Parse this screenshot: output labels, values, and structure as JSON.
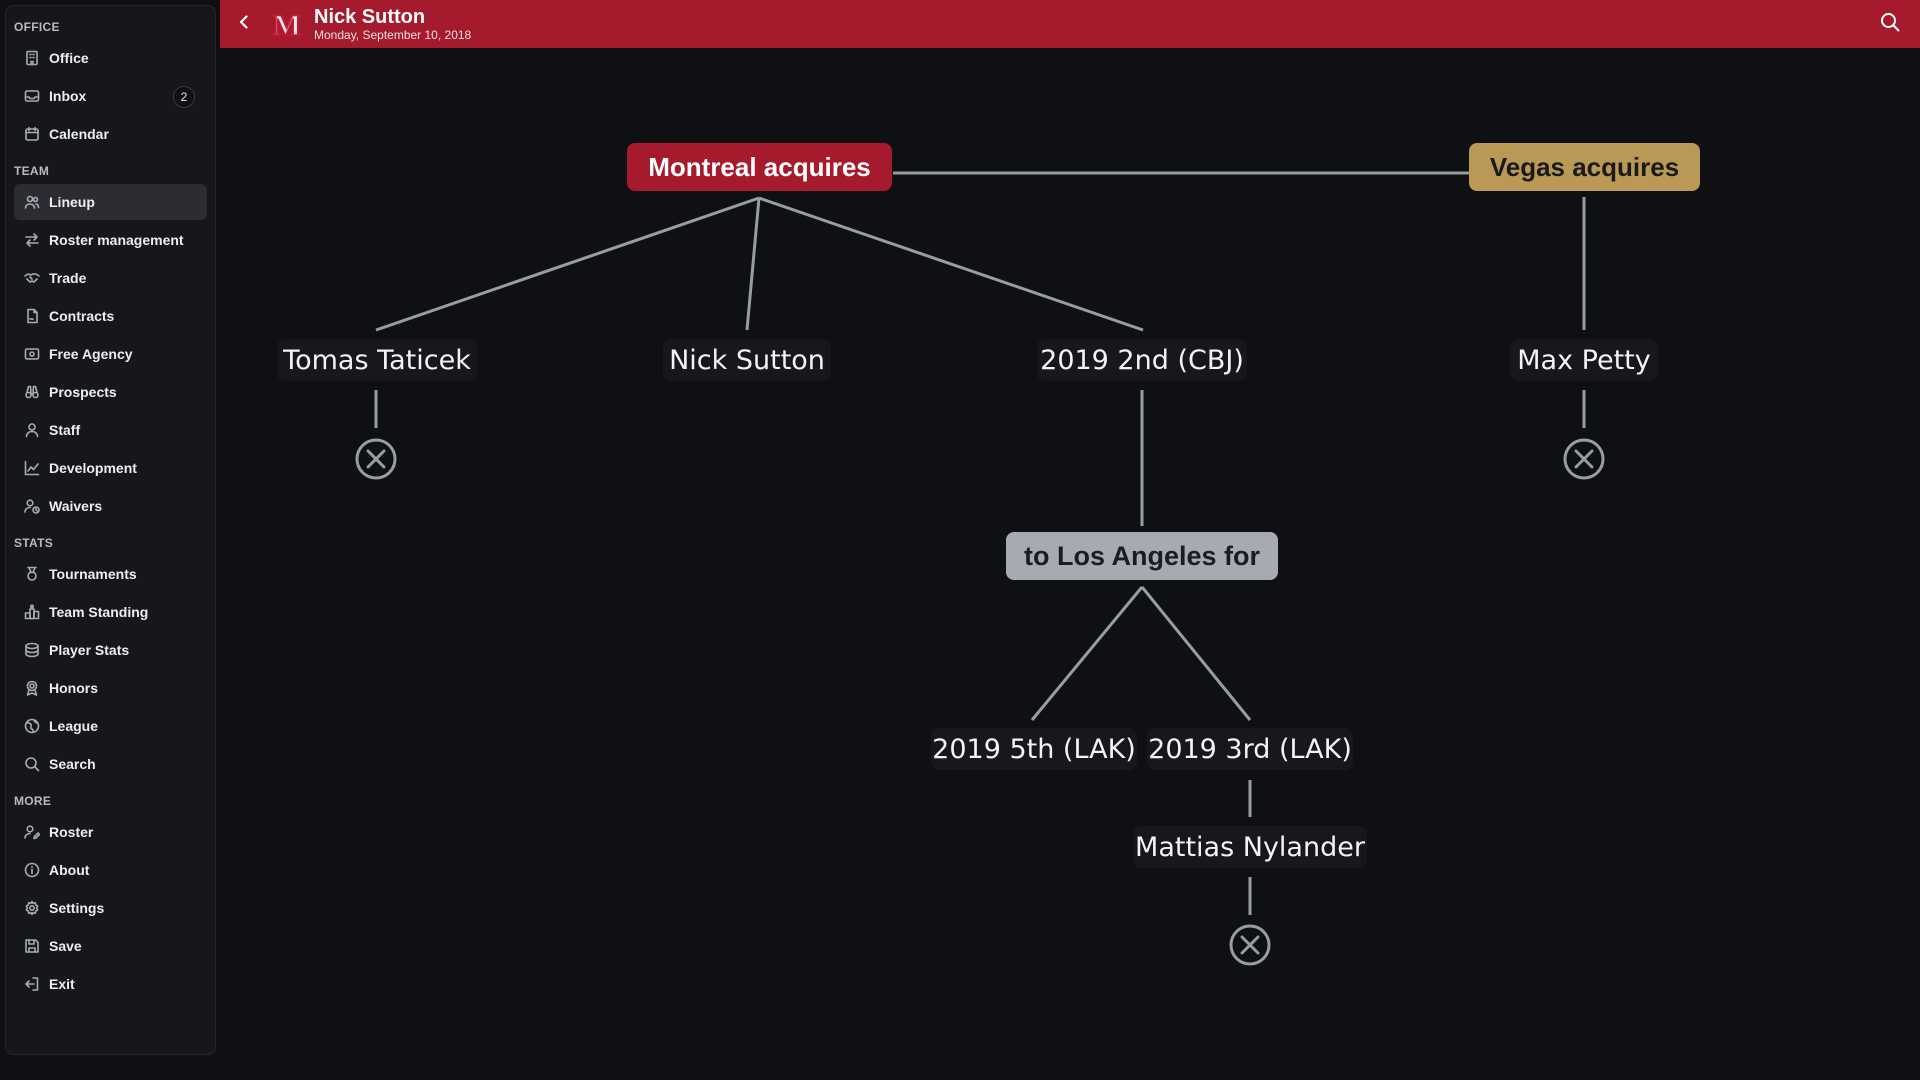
{
  "header": {
    "title": "Nick Sutton",
    "date": "Monday, September 10, 2018",
    "logo_letter": "M",
    "accent_color": "#a61a2e"
  },
  "sidebar": {
    "sections": [
      {
        "title": "OFFICE",
        "items": [
          {
            "label": "Office",
            "icon": "building-icon"
          },
          {
            "label": "Inbox",
            "icon": "inbox-icon",
            "badge": "2"
          },
          {
            "label": "Calendar",
            "icon": "calendar-icon"
          }
        ]
      },
      {
        "title": "TEAM",
        "items": [
          {
            "label": "Lineup",
            "icon": "users-icon",
            "active": true
          },
          {
            "label": "Roster management",
            "icon": "arrows-swap-icon"
          },
          {
            "label": "Trade",
            "icon": "handshake-icon"
          },
          {
            "label": "Contracts",
            "icon": "contract-icon"
          },
          {
            "label": "Free Agency",
            "icon": "id-card-icon"
          },
          {
            "label": "Prospects",
            "icon": "binoculars-icon"
          },
          {
            "label": "Staff",
            "icon": "user-icon"
          },
          {
            "label": "Development",
            "icon": "chart-line-icon"
          },
          {
            "label": "Waivers",
            "icon": "user-clock-icon"
          }
        ]
      },
      {
        "title": "STATS",
        "items": [
          {
            "label": "Tournaments",
            "icon": "medal-icon"
          },
          {
            "label": "Team Standing",
            "icon": "podium-icon"
          },
          {
            "label": "Player Stats",
            "icon": "database-icon"
          },
          {
            "label": "Honors",
            "icon": "award-icon"
          },
          {
            "label": "League",
            "icon": "globe-icon"
          },
          {
            "label": "Search",
            "icon": "search-icon"
          }
        ]
      },
      {
        "title": "MORE",
        "items": [
          {
            "label": "Roster",
            "icon": "user-edit-icon"
          },
          {
            "label": "About",
            "icon": "info-icon"
          },
          {
            "label": "Settings",
            "icon": "gear-icon"
          },
          {
            "label": "Save",
            "icon": "save-icon"
          },
          {
            "label": "Exit",
            "icon": "exit-icon"
          }
        ]
      }
    ]
  },
  "trade_tree": {
    "montreal_label": "Montreal acquires",
    "vegas_label": "Vegas acquires",
    "montreal_color": "#a61a2e",
    "vegas_color": "#b99955",
    "assets": {
      "taticek": "Tomas Taticek",
      "sutton": "Nick Sutton",
      "pick_cbj": "2019 2nd (CBJ)",
      "petty": "Max Petty",
      "deal": "to Los Angeles for",
      "pick_lak_5th": "2019 5th (LAK)",
      "pick_lak_3rd": "2019 3rd (LAK)",
      "nylander": "Mattias Nylander"
    }
  }
}
